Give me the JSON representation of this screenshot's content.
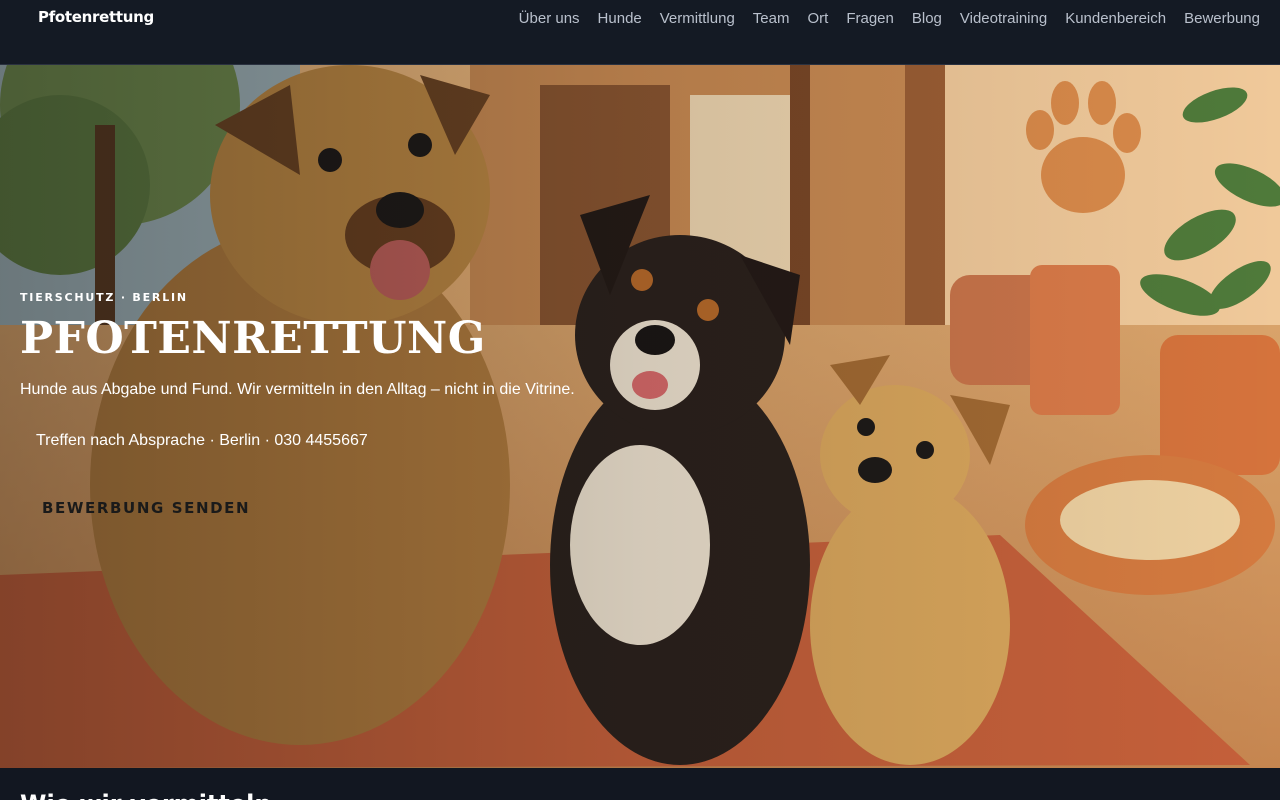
{
  "header": {
    "brand": "Pfotenrettung",
    "nav": [
      "Über uns",
      "Hunde",
      "Vermittlung",
      "Team",
      "Ort",
      "Fragen",
      "Blog",
      "Videotraining",
      "Kundenbereich",
      "Bewerbung"
    ]
  },
  "hero": {
    "eyebrow": "TIERSCHUTZ · BERLIN",
    "title": "PFOTENRETTUNG",
    "subtitle": "Hunde aus Abgabe und Fund. Wir vermitteln in den Alltag – nicht in die Vitrine.",
    "meta": "Treffen nach Absprache · Berlin · 030 4455667",
    "cta_label": "BEWERBUNG SENDEN",
    "image": "illustration of three dogs sitting on a rug in a shelter courtyard"
  },
  "section": {
    "heading": "Wie wir vermitteln"
  }
}
